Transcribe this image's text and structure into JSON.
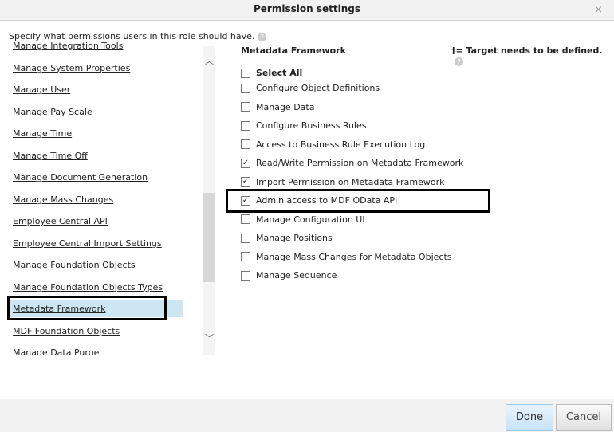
{
  "dialog": {
    "title": "Permission settings",
    "close": "×"
  },
  "intro": "Specify what permissions users in this role should have.",
  "categories": [
    "Manage Integration Tools",
    "Manage System Properties",
    "Manage User",
    "Manage Pay Scale",
    "Manage Time",
    "Manage Time Off",
    "Manage Document Generation",
    "Manage Mass Changes",
    "Employee Central API",
    "Employee Central Import Settings",
    "Manage Foundation Objects",
    "Manage Foundation Objects Types",
    "Metadata Framework",
    "MDF Foundation Objects",
    "Manage Data Purge"
  ],
  "selected_category": "Metadata Framework",
  "panel": {
    "title": "Metadata Framework",
    "note": "†= Target needs to be defined.",
    "select_all": {
      "label": "Select All",
      "checked": false
    },
    "permissions": [
      {
        "label": "Configure Object Definitions",
        "checked": false
      },
      {
        "label": "Manage Data",
        "checked": false
      },
      {
        "label": "Configure Business Rules",
        "checked": false
      },
      {
        "label": "Access to Business Rule Execution Log",
        "checked": false
      },
      {
        "label": "Read/Write Permission on Metadata Framework",
        "checked": true
      },
      {
        "label": "Import Permission on Metadata Framework",
        "checked": true
      },
      {
        "label": "Admin access to MDF OData API",
        "checked": true
      },
      {
        "label": "Manage Configuration UI",
        "checked": false
      },
      {
        "label": "Manage Positions",
        "checked": false
      },
      {
        "label": "Manage Mass Changes for Metadata Objects",
        "checked": false
      },
      {
        "label": "Manage Sequence",
        "checked": false
      }
    ]
  },
  "buttons": {
    "done": "Done",
    "cancel": "Cancel"
  }
}
